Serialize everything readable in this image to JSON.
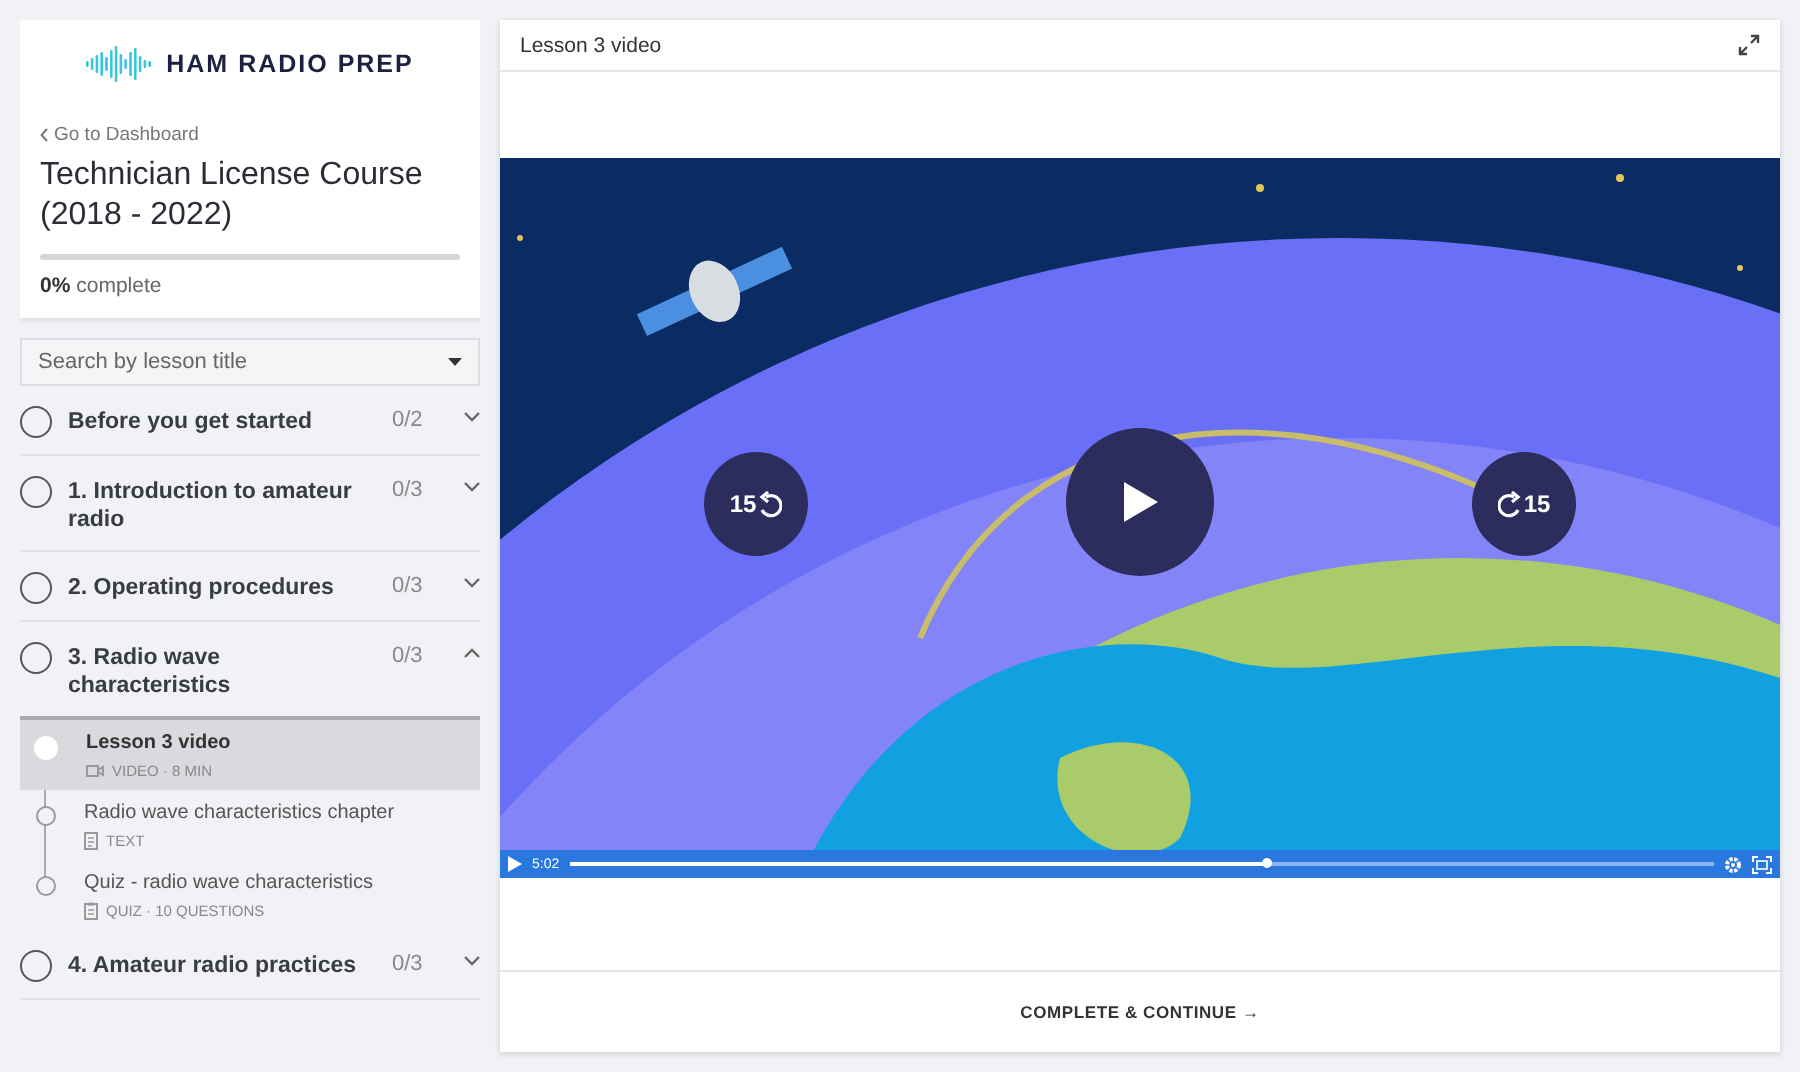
{
  "logo": {
    "text": "HAM RADIO PREP"
  },
  "course": {
    "back_link": "Go to Dashboard",
    "title": "Technician License Course (2018 - 2022)",
    "progress": {
      "level": 0
    },
    "percent": "0%",
    "percent_label": "complete"
  },
  "search": {
    "placeholder": "Search by lesson title"
  },
  "sections": [
    {
      "title": "Before you get started",
      "count": "0/2",
      "expanded": false
    },
    {
      "title": "1. Introduction to amateur radio",
      "count": "0/3",
      "expanded": false
    },
    {
      "title": "2. Operating procedures",
      "count": "0/3",
      "expanded": false
    },
    {
      "title": "3. Radio wave characteristics",
      "count": "0/3",
      "expanded": true,
      "lessons": [
        {
          "title": "Lesson 3 video",
          "kind": "video",
          "meta": "VIDEO · 8 MIN",
          "selected": true
        },
        {
          "title": "Radio wave characteristics chapter",
          "kind": "text",
          "meta": "TEXT",
          "selected": false
        },
        {
          "title": "Quiz - radio wave characteristics",
          "kind": "quiz",
          "meta": "QUIZ · 10 QUESTIONS",
          "selected": false
        }
      ]
    },
    {
      "title": "4. Amateur radio practices",
      "count": "0/3",
      "expanded": false
    }
  ],
  "lesson_panel": {
    "title": "Lesson 3 video"
  },
  "player": {
    "skip_back": "15",
    "skip_forward": "15",
    "time": "5:02",
    "progress": {
      "level": 0.61
    }
  },
  "footer": {
    "button": "COMPLETE & CONTINUE →"
  }
}
